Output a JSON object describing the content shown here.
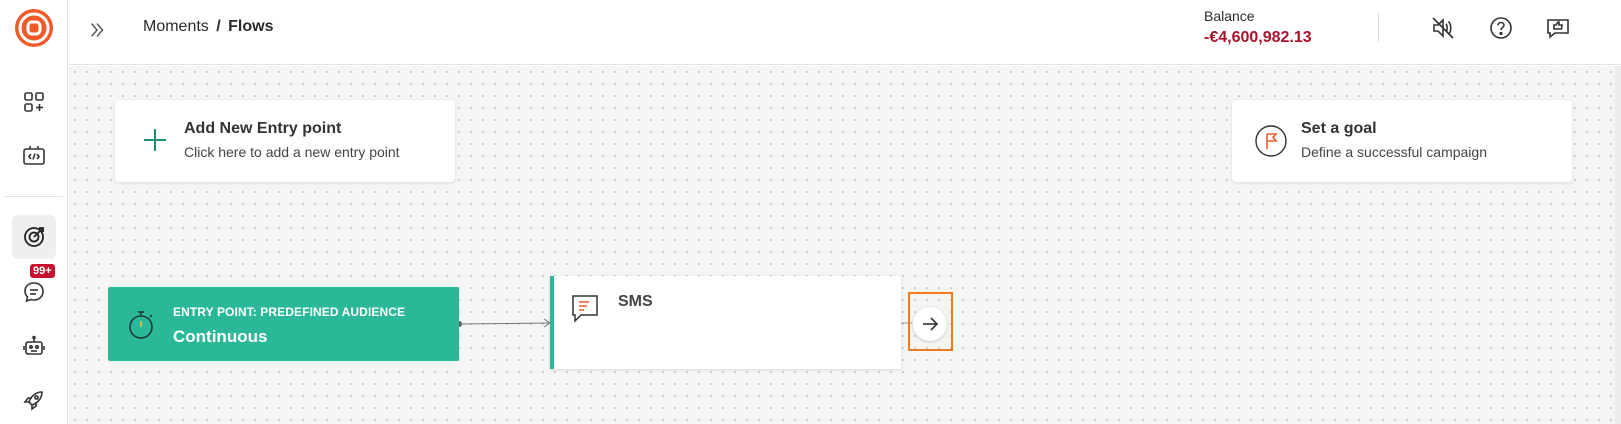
{
  "header": {
    "breadcrumb_parent": "Moments",
    "breadcrumb_sep": "/",
    "breadcrumb_current": "Flows",
    "balance_label": "Balance",
    "balance_value": "-€4,600,982.13"
  },
  "sidebar": {
    "badge": "99+",
    "items": [
      {
        "icon": "apps-add-icon"
      },
      {
        "icon": "developer-code-icon"
      },
      {
        "icon": "target-icon",
        "active": true
      },
      {
        "icon": "chat-bubble-icon"
      },
      {
        "icon": "bot-icon"
      },
      {
        "icon": "rocket-icon"
      }
    ]
  },
  "canvas": {
    "add_entry": {
      "title": "Add New Entry point",
      "subtitle": "Click here to add a new entry point"
    },
    "goal": {
      "title": "Set a goal",
      "subtitle": "Define a successful campaign"
    },
    "entry_node": {
      "kicker": "ENTRY POINT: PREDEFINED AUDIENCE",
      "name": "Continuous"
    },
    "sms_node": {
      "label": "SMS"
    }
  },
  "colors": {
    "brand_orange": "#f05a28",
    "teal": "#2bb898",
    "balance_red": "#a8132b",
    "highlight_orange": "#f07b1d"
  }
}
